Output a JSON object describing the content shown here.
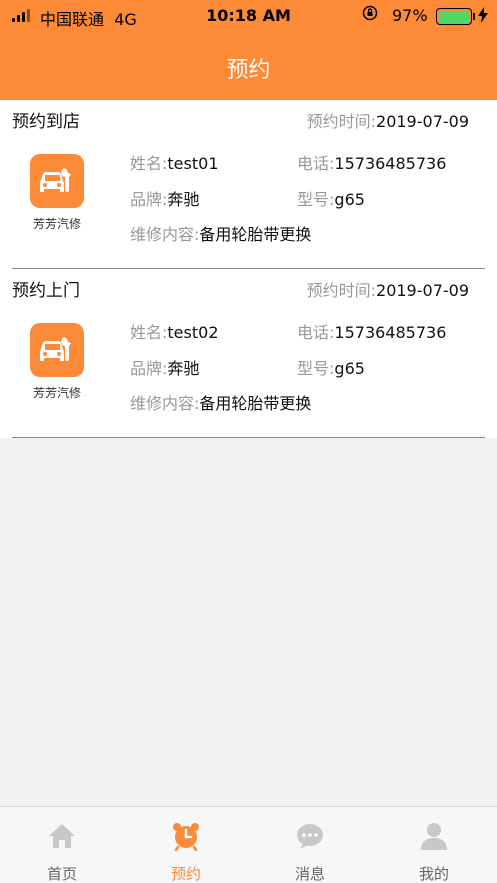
{
  "status_bar": {
    "carrier": "中国联通",
    "network": "4G",
    "time": "10:18 AM",
    "battery": "97%",
    "battery_level": 0.97
  },
  "nav": {
    "title": "预约"
  },
  "appointments": [
    {
      "type": "预约到店",
      "time_label": "预约时间:",
      "time_value": "2019-07-09",
      "shop_name": "芳芳汽修",
      "name_label": "姓名:",
      "name_value": "test01",
      "phone_label": "电话:",
      "phone_value": "15736485736",
      "brand_label": "品牌:",
      "brand_value": "奔驰",
      "model_label": "型号:",
      "model_value": "g65",
      "content_label": "维修内容:",
      "content_value": "备用轮胎带更换"
    },
    {
      "type": "预约上门",
      "time_label": "预约时间:",
      "time_value": "2019-07-09",
      "shop_name": "芳芳汽修",
      "name_label": "姓名:",
      "name_value": "test02",
      "phone_label": "电话:",
      "phone_value": "15736485736",
      "brand_label": "品牌:",
      "brand_value": "奔驰",
      "model_label": "型号:",
      "model_value": "g65",
      "content_label": "维修内容:",
      "content_value": "备用轮胎带更换"
    }
  ],
  "tabs": [
    {
      "label": "首页",
      "icon": "home-icon"
    },
    {
      "label": "预约",
      "icon": "alarm-clock-icon",
      "active": true
    },
    {
      "label": "消息",
      "icon": "chat-bubble-icon"
    },
    {
      "label": "我的",
      "icon": "user-icon"
    }
  ],
  "colors": {
    "accent": "#fc8a36",
    "background": "#f2f2f2",
    "label_gray": "#999999",
    "tab_inactive": "#666666"
  }
}
